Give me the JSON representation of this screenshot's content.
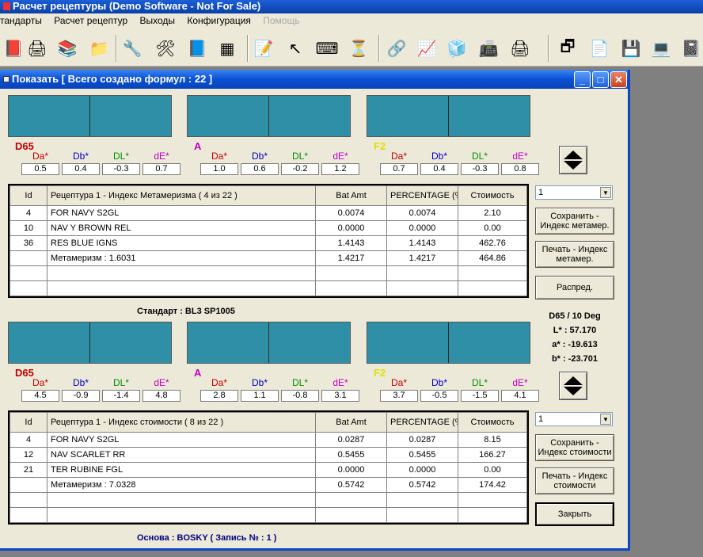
{
  "app": {
    "title": "Расчет рецептуры (Demo Software - Not For Sale)"
  },
  "menu": [
    {
      "label": "тандарты",
      "disabled": false
    },
    {
      "label": "Расчет рецептур",
      "disabled": false
    },
    {
      "label": "Выходы",
      "disabled": false
    },
    {
      "label": "Конфигурация",
      "disabled": false
    },
    {
      "label": "Помощь",
      "disabled": true
    }
  ],
  "toolbar_icons": [
    "book-icon",
    "printer-icon",
    "books-icon",
    "folder-icon",
    "wrench-icon",
    "tools-icon",
    "books-shelf-icon",
    "calculator-icon",
    "notepad-icon",
    "pointer-icon",
    "keyboard-icon",
    "hourglass-icon",
    "network-icon",
    "chart-icon",
    "cubes-icon",
    "scanner-icon",
    "printer-icon",
    "windows-icon",
    "copy-icon",
    "disk-icon",
    "computer-icon",
    "edit-book-icon"
  ],
  "window": {
    "title": "Показать [ Всего создано формул : 22 ]"
  },
  "colors": {
    "swatch": "#2f8fa6",
    "d65": "#c00000",
    "a": "#c000c0",
    "f2": "#e0e000",
    "da": "#c00000",
    "db": "#0000c0",
    "dl": "#009000",
    "de": "#c000c0"
  },
  "upper": {
    "illuminants": [
      {
        "name": "D65",
        "da": "0.5",
        "db": "0.4",
        "dl": "-0.3",
        "de": "0.7"
      },
      {
        "name": "A",
        "da": "1.0",
        "db": "0.6",
        "dl": "-0.2",
        "de": "1.2"
      },
      {
        "name": "F2",
        "da": "0.7",
        "db": "0.4",
        "dl": "-0.3",
        "de": "0.8"
      }
    ],
    "headers": {
      "id": "Id",
      "recipe": "Рецептура 1 - Индекс Метамеризма ( 4 из 22 )",
      "bat": "Bat Amt",
      "pct": "PERCENTAGE (%)",
      "cost": "Стоимость"
    },
    "rows": [
      {
        "id": "4",
        "name": "FOR NAVY S2GL",
        "bat": "0.0074",
        "pct": "0.0074",
        "cost": "2.10"
      },
      {
        "id": "10",
        "name": "NAV Y BROWN REL",
        "bat": "0.0000",
        "pct": "0.0000",
        "cost": "0.00"
      },
      {
        "id": "36",
        "name": "RES BLUE IGNS",
        "bat": "1.4143",
        "pct": "1.4143",
        "cost": "462.76"
      },
      {
        "id": "",
        "name": "Метамеризм : 1.6031",
        "bat": "1.4217",
        "pct": "1.4217",
        "cost": "464.86"
      },
      {
        "id": "",
        "name": "",
        "bat": "",
        "pct": "",
        "cost": ""
      },
      {
        "id": "",
        "name": "",
        "bat": "",
        "pct": "",
        "cost": ""
      }
    ],
    "combo": "1",
    "save_btn": "Сохранить - Индекс метамер.",
    "print_btn": "Печать - Индекс метамер.",
    "distr_btn": "Распред."
  },
  "standard_caption": "Стандарт : BL3 SP1005",
  "color_info": {
    "cond": "D65 / 10 Deg",
    "l": "L* : 57.170",
    "a": "a* : -19.613",
    "b": "b* : -23.701"
  },
  "lower": {
    "illuminants": [
      {
        "name": "D65",
        "da": "4.5",
        "db": "-0.9",
        "dl": "-1.4",
        "de": "4.8"
      },
      {
        "name": "A",
        "da": "2.8",
        "db": "1.1",
        "dl": "-0.8",
        "de": "3.1"
      },
      {
        "name": "F2",
        "da": "3.7",
        "db": "-0.5",
        "dl": "-1.5",
        "de": "4.1"
      }
    ],
    "headers": {
      "id": "Id",
      "recipe": "Рецептура 1 - Индекс стоимости ( 8 из 22 )",
      "bat": "Bat Amt",
      "pct": "PERCENTAGE (%)",
      "cost": "Стоимость"
    },
    "rows": [
      {
        "id": "4",
        "name": "FOR NAVY S2GL",
        "bat": "0.0287",
        "pct": "0.0287",
        "cost": "8.15"
      },
      {
        "id": "12",
        "name": "NAV SCARLET RR",
        "bat": "0.5455",
        "pct": "0.5455",
        "cost": "166.27"
      },
      {
        "id": "21",
        "name": "TER RUBINE FGL",
        "bat": "0.0000",
        "pct": "0.0000",
        "cost": "0.00"
      },
      {
        "id": "",
        "name": "Метамеризм : 7.0328",
        "bat": "0.5742",
        "pct": "0.5742",
        "cost": "174.42"
      },
      {
        "id": "",
        "name": "",
        "bat": "",
        "pct": "",
        "cost": ""
      },
      {
        "id": "",
        "name": "",
        "bat": "",
        "pct": "",
        "cost": ""
      }
    ],
    "combo": "1",
    "save_btn": "Сохранить - Индекс стоимости",
    "print_btn": "Печать - Индекс стоимости",
    "close_btn": "Закрыть"
  },
  "labels": {
    "da": "Da*",
    "db": "Db*",
    "dl": "DL*",
    "de": "dE*"
  },
  "base_caption": "Основа : BOSKY ( Запись № : 1 )"
}
